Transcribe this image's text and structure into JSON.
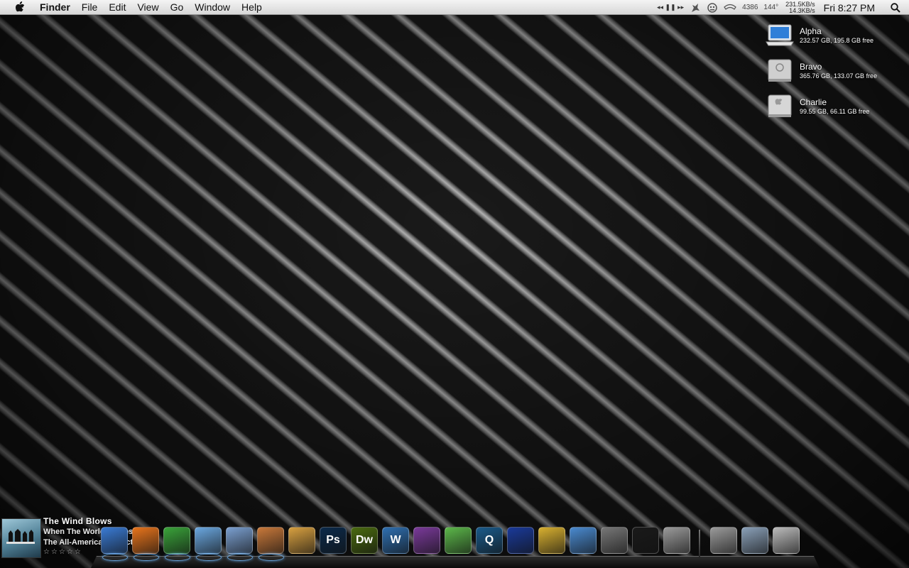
{
  "menubar": {
    "app_name": "Finder",
    "menus": [
      "File",
      "Edit",
      "View",
      "Go",
      "Window",
      "Help"
    ],
    "media_controls": "◂◂ ❚❚ ▸▸",
    "status_number": "4386",
    "temperature": "144°",
    "net_up": "231.5KB/s",
    "net_down": "14.3KB/s",
    "clock": "Fri 8:27 PM"
  },
  "drives": [
    {
      "name": "Alpha",
      "info": "232.57 GB, 195.8 GB free",
      "icon": "laptop-drive-icon"
    },
    {
      "name": "Bravo",
      "info": "365.76 GB, 133.07 GB free",
      "icon": "external-drive-icon"
    },
    {
      "name": "Charlie",
      "info": "99.55 GB, 66.11 GB free",
      "icon": "apple-drive-icon"
    }
  ],
  "now_playing": {
    "title": "The Wind Blows",
    "album": "When The World Comes Down",
    "artist": "The All-American Rejects",
    "rating": "☆☆☆☆☆"
  },
  "dock": {
    "apps": [
      {
        "name": "finder",
        "label": "",
        "color": "#3a7bd5"
      },
      {
        "name": "firefox",
        "label": "",
        "color": "#e8741c"
      },
      {
        "name": "adium",
        "label": "",
        "color": "#3aa33a"
      },
      {
        "name": "itunes",
        "label": "",
        "color": "#6aa7e0"
      },
      {
        "name": "mail",
        "label": "",
        "color": "#7a9fd0"
      },
      {
        "name": "iphoto",
        "label": "",
        "color": "#c8783a"
      },
      {
        "name": "aperture",
        "label": "",
        "color": "#d8a040"
      },
      {
        "name": "photoshop",
        "label": "Ps",
        "color": "#0b2a4a"
      },
      {
        "name": "dreamweaver",
        "label": "Dw",
        "color": "#4a6a10"
      },
      {
        "name": "word",
        "label": "W",
        "color": "#2f6fb0"
      },
      {
        "name": "ical",
        "label": "",
        "color": "#7a3a9a"
      },
      {
        "name": "evernote",
        "label": "",
        "color": "#5cb84a"
      },
      {
        "name": "quicksilver",
        "label": "Q",
        "color": "#1a5a8a"
      },
      {
        "name": "cyberduck",
        "label": "",
        "color": "#1a3a9a"
      },
      {
        "name": "transmit",
        "label": "",
        "color": "#d8b030"
      },
      {
        "name": "safari",
        "label": "",
        "color": "#4a8ad0"
      },
      {
        "name": "dvd-player",
        "label": "",
        "color": "#777777"
      },
      {
        "name": "activity-monitor",
        "label": "",
        "color": "#1a1a1a"
      },
      {
        "name": "system-preferences",
        "label": "",
        "color": "#9a9a9a"
      }
    ],
    "right": [
      {
        "name": "downloads",
        "label": "",
        "color": "#9a9a9a"
      },
      {
        "name": "applications",
        "label": "",
        "color": "#8aa0b8"
      },
      {
        "name": "trash",
        "label": "",
        "color": "#bbbbbb"
      }
    ]
  }
}
